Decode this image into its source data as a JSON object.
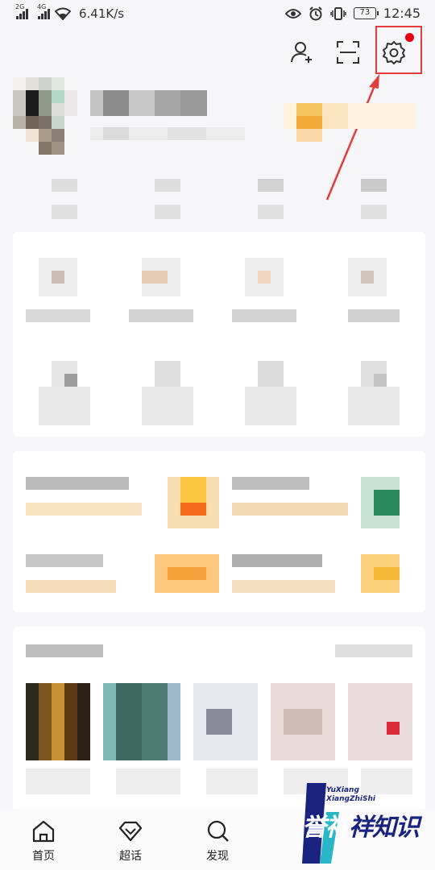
{
  "status_bar": {
    "net1": "2G",
    "net2": "4G",
    "speed": "6.41K/s",
    "battery": "73",
    "time": "12:45"
  },
  "header": {
    "icons": [
      "add-friend-icon",
      "scan-icon",
      "settings-icon"
    ],
    "settings_badge_color": "#e60012",
    "highlight_color": "#e23c3c"
  },
  "bottom_nav": {
    "items": [
      {
        "label": "首页",
        "icon": "home-icon"
      },
      {
        "label": "超话",
        "icon": "diamond-icon"
      },
      {
        "label": "发现",
        "icon": "search-icon"
      }
    ]
  },
  "watermark": {
    "latin_line1": "YuXiang",
    "latin_line2": "XiangZhiShi",
    "chinese": "誉祥祥知识"
  }
}
